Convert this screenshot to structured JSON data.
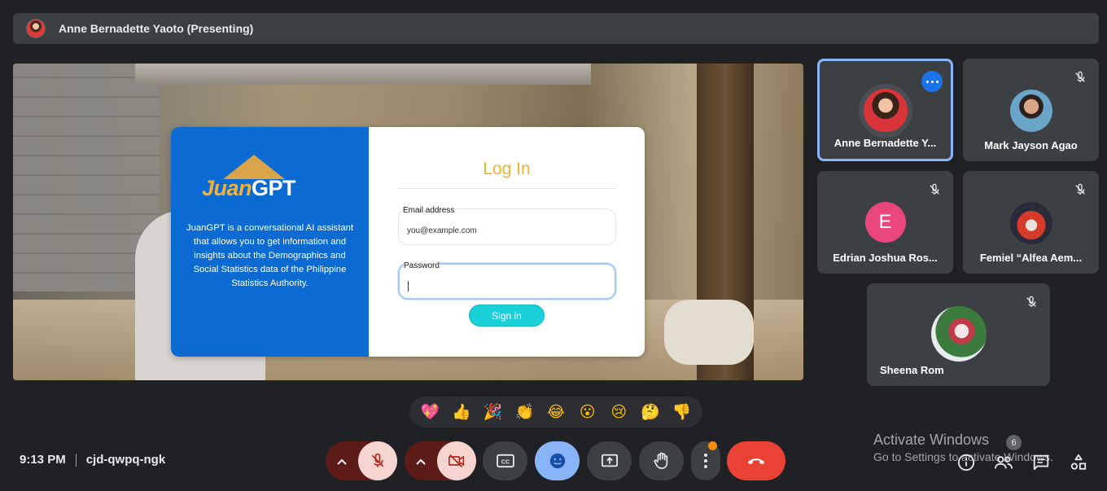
{
  "presenter": {
    "name": "Anne Bernadette Yaoto (Presenting)"
  },
  "login": {
    "logo_prefix": "Juan",
    "logo_suffix": "GPT",
    "description": "JuanGPT is a conversational AI assistant that allows you to get information and insights about the Demographics and Social Statistics data of the Philippine Statistics Authority.",
    "title": "Log In",
    "email_label": "Email address",
    "email_value": "you@example.com",
    "password_label": "Password",
    "signin_label": "Sign in"
  },
  "participants": [
    {
      "name": "Anne Bernadette Y...",
      "muted": false,
      "active": true
    },
    {
      "name": "Mark Jayson Agao",
      "muted": true
    },
    {
      "name": "Edrian Joshua Ros...",
      "initial": "E",
      "muted": true
    },
    {
      "name": "Femiel “Alfea Aem...",
      "muted": true
    },
    {
      "name": "Sheena Rom",
      "muted": true
    }
  ],
  "reactions": [
    "💖",
    "👍",
    "🎉",
    "👏",
    "😂",
    "😮",
    "😢",
    "🤔",
    "👎"
  ],
  "meeting": {
    "time": "9:13 PM",
    "code": "cjd-qwpq-ngk"
  },
  "watermark": {
    "line1": "Activate Windows",
    "line2": "Go to Settings to activate Windows."
  },
  "people_count": "6",
  "colors": {
    "background": "#202124",
    "tile": "#3c4043",
    "accent_blue": "#8ab4f8",
    "end_call": "#ea4335",
    "login_blue": "#0b6bd3",
    "login_title": "#ebb22e",
    "signin": "#1ad1d9"
  }
}
